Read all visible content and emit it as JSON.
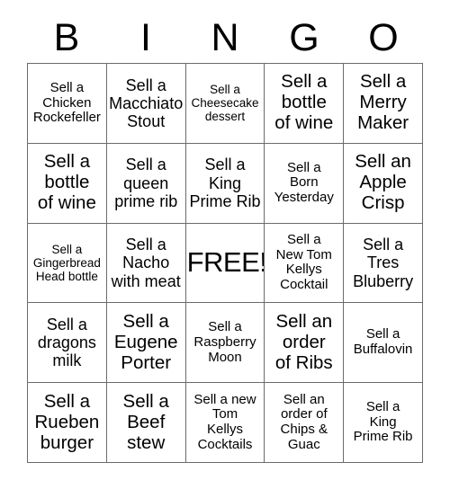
{
  "card": {
    "title_letters": [
      "B",
      "I",
      "N",
      "G",
      "O"
    ],
    "free_space_label": "FREE!",
    "grid": {
      "rows": 5,
      "columns": 5,
      "border_color": "#6b6b6b",
      "background_color": "#ffffff",
      "text_color": "#000000"
    },
    "cells": [
      [
        {
          "text": "Sell a\nChicken\nRockefeller",
          "size": "sm"
        },
        {
          "text": "Sell a\nMacchiato\nStout",
          "size": "md"
        },
        {
          "text": "Sell a\nCheesecake\ndessert",
          "size": "xs"
        },
        {
          "text": "Sell a\nbottle\nof wine",
          "size": "lg"
        },
        {
          "text": "Sell a\nMerry\nMaker",
          "size": "lg"
        }
      ],
      [
        {
          "text": "Sell a\nbottle\nof wine",
          "size": "lg"
        },
        {
          "text": "Sell a\nqueen\nprime rib",
          "size": "md"
        },
        {
          "text": "Sell a\nKing\nPrime Rib",
          "size": "md"
        },
        {
          "text": "Sell a\nBorn\nYesterday",
          "size": "sm"
        },
        {
          "text": "Sell an\nApple\nCrisp",
          "size": "lg"
        }
      ],
      [
        {
          "text": "Sell a\nGingerbread\nHead bottle",
          "size": "xs"
        },
        {
          "text": "Sell a\nNacho\nwith meat",
          "size": "md"
        },
        {
          "text": "FREE!",
          "size": "free"
        },
        {
          "text": "Sell a\nNew Tom\nKellys\nCocktail",
          "size": "sm"
        },
        {
          "text": "Sell a\nTres\nBluberry",
          "size": "md"
        }
      ],
      [
        {
          "text": "Sell a\ndragons\nmilk",
          "size": "md"
        },
        {
          "text": "Sell a\nEugene\nPorter",
          "size": "lg"
        },
        {
          "text": "Sell a\nRaspberry\nMoon",
          "size": "sm"
        },
        {
          "text": "Sell an\norder\nof Ribs",
          "size": "lg"
        },
        {
          "text": "Sell a\nBuffalovin",
          "size": "sm"
        }
      ],
      [
        {
          "text": "Sell a\nRueben\nburger",
          "size": "lg"
        },
        {
          "text": "Sell a\nBeef\nstew",
          "size": "lg"
        },
        {
          "text": "Sell a new\nTom\nKellys\nCocktails",
          "size": "sm"
        },
        {
          "text": "Sell an\norder of\nChips &\nGuac",
          "size": "sm"
        },
        {
          "text": "Sell a\nKing\nPrime Rib",
          "size": "sm"
        }
      ]
    ]
  }
}
